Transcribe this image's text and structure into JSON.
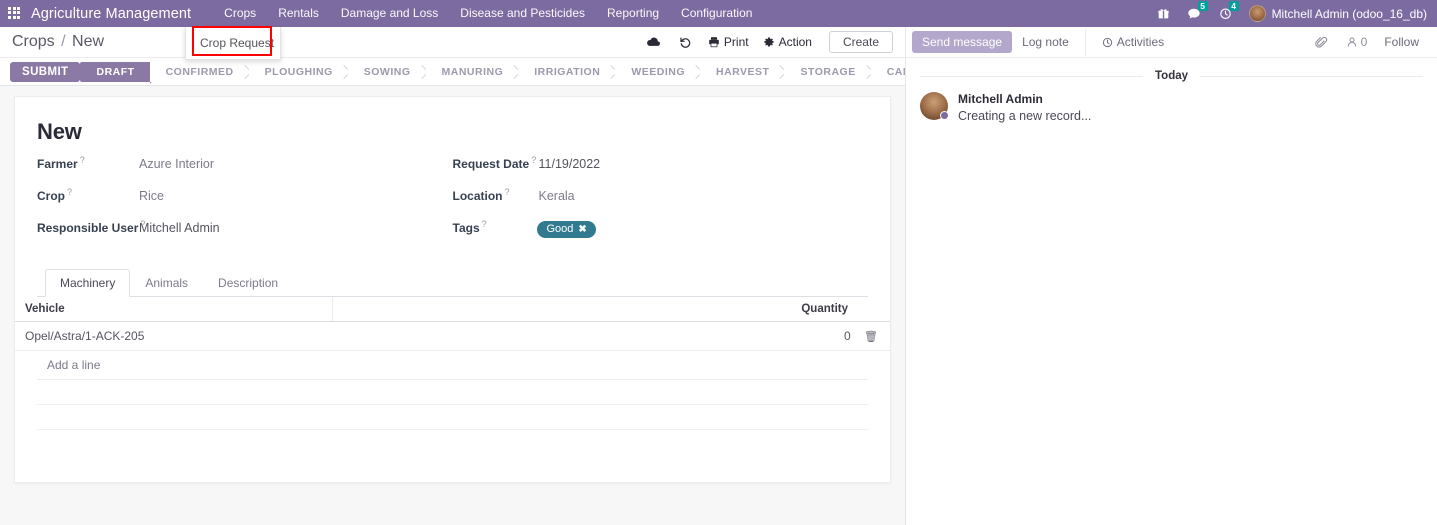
{
  "navbar": {
    "apps_icon": "apps-grid-icon",
    "brand": "Agriculture Management",
    "menu_items": [
      {
        "label": "Crops"
      },
      {
        "label": "Rentals"
      },
      {
        "label": "Damage and Loss"
      },
      {
        "label": "Disease and Pesticides"
      },
      {
        "label": "Reporting"
      },
      {
        "label": "Configuration"
      }
    ],
    "right": {
      "gift_icon": "gift-icon",
      "messages_icon": "messages-icon",
      "messages_count": "5",
      "activities_icon": "clock-activity-icon",
      "activities_count": "4",
      "avatar": "user-avatar",
      "user_name": "Mitchell Admin (odoo_16_db)"
    }
  },
  "dropdown": {
    "items": [
      {
        "label": "Crop Request"
      }
    ]
  },
  "control_panel": {
    "breadcrumb_root": "Crops",
    "breadcrumb_sep": "/",
    "breadcrumb_current": "New",
    "save_icon": "cloud-save-icon",
    "discard_icon": "discard-undo-icon",
    "print_icon": "printer-icon",
    "print_label": "Print",
    "action_icon": "gear-icon",
    "action_label": "Action",
    "create_label": "Create"
  },
  "statusbar": {
    "submit_label": "SUBMIT",
    "stages": [
      {
        "label": "DRAFT",
        "active": true
      },
      {
        "label": "CONFIRMED",
        "active": false
      },
      {
        "label": "PLOUGHING",
        "active": false
      },
      {
        "label": "SOWING",
        "active": false
      },
      {
        "label": "MANURING",
        "active": false
      },
      {
        "label": "IRRIGATION",
        "active": false
      },
      {
        "label": "WEEDING",
        "active": false
      },
      {
        "label": "HARVEST",
        "active": false
      },
      {
        "label": "STORAGE",
        "active": false
      },
      {
        "label": "CANCEL",
        "active": false
      }
    ]
  },
  "form": {
    "title": "New",
    "tooltip_marker": "?",
    "left_fields": [
      {
        "label": "Farmer",
        "value": "Azure Interior"
      },
      {
        "label": "Crop",
        "value": "Rice"
      },
      {
        "label": "Responsible User",
        "value": "Mitchell Admin"
      }
    ],
    "right_fields": [
      {
        "label": "Request Date",
        "value": "11/19/2022"
      },
      {
        "label": "Location",
        "value": "Kerala"
      }
    ],
    "tags_label": "Tags",
    "tags": [
      {
        "label": "Good",
        "color": "#327a90",
        "remove_icon": "close-x-icon"
      }
    ]
  },
  "notebook": {
    "tabs": [
      {
        "label": "Machinery",
        "active": true
      },
      {
        "label": "Animals",
        "active": false
      },
      {
        "label": "Description",
        "active": false
      }
    ],
    "table": {
      "columns": [
        "Vehicle",
        "Quantity"
      ],
      "rows": [
        {
          "vehicle": "Opel/Astra/1-ACK-205",
          "quantity": "0",
          "delete_icon": "trash-icon"
        }
      ],
      "add_line_label": "Add a line"
    }
  },
  "chatter": {
    "send_message_label": "Send message",
    "log_note_label": "Log note",
    "activities_icon": "clock-icon",
    "activities_label": "Activities",
    "attachment_icon": "paperclip-icon",
    "followers_icon": "follower-user-icon",
    "followers_count": "0",
    "follow_label": "Follow",
    "day_separator": "Today",
    "messages": [
      {
        "author": "Mitchell Admin",
        "body": "Creating a new record...",
        "avatar": "author-avatar"
      }
    ]
  },
  "colors": {
    "brand_purple": "#7c6ba0",
    "button_purple": "#8b79a5",
    "tag_teal": "#327a90",
    "badge_teal": "#00a09d",
    "annotation_red": "#ff0000",
    "page_bg": "#f7f7f8"
  }
}
